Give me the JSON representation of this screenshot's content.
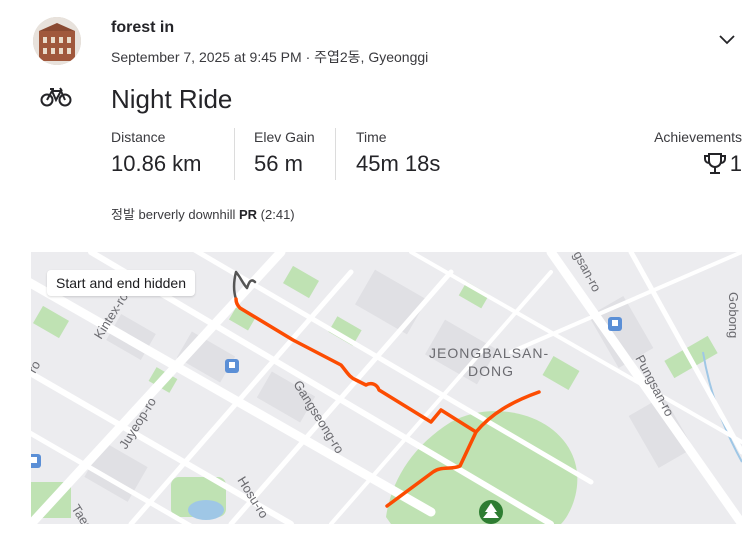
{
  "activity": {
    "athlete_name": "forest in",
    "datetime_location": "September 7, 2025 at 9:45 PM · 주엽2동, Gyeonggi",
    "sport_icon": "bicycle-icon",
    "title": "Night Ride"
  },
  "stats": [
    {
      "label": "Distance",
      "value": "10.86 km"
    },
    {
      "label": "Elev Gain",
      "value": "56 m"
    },
    {
      "label": "Time",
      "value": "45m 18s"
    }
  ],
  "achievements": {
    "label": "Achievements",
    "count": "1",
    "icon": "trophy-icon"
  },
  "segment": {
    "name": "정발 berverly downhill",
    "pr_label": "PR",
    "time": "(2:41)"
  },
  "map": {
    "privacy_badge": "Start and end hidden",
    "labels": {
      "district_line1": "JEONGBALSAN-",
      "district_line2": "DONG",
      "kintex": "Kintex-ro",
      "gangseong": "Gangseong-ro",
      "juyeop": "Juyeop-ro",
      "hosu": "Hosu-ro",
      "pungsan": "Pungsan-ro",
      "gangsan": "gsan-ro",
      "gobong": "Gobong",
      "left_ro": "ro",
      "taeg": "Taeg"
    },
    "route_color": "#fc4c02",
    "hidden_route_color": "#555555",
    "park_icon": "tree-icon",
    "metro_icon": "subway-icon"
  }
}
